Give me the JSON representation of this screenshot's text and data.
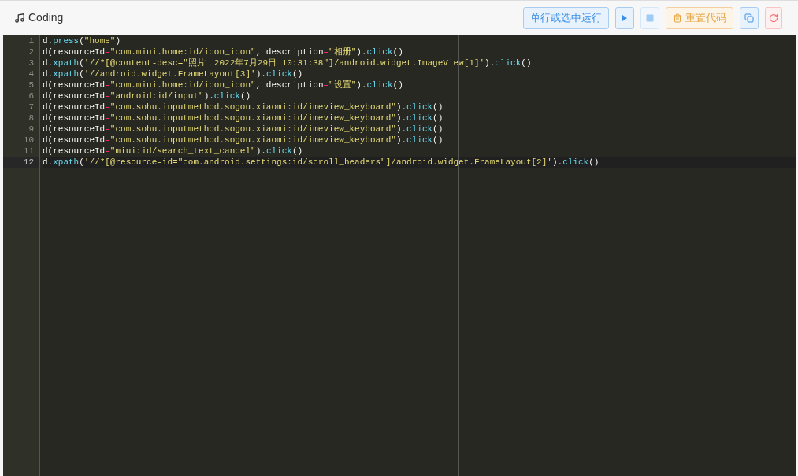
{
  "header": {
    "title": "Coding"
  },
  "toolbar": [
    {
      "kind": "text",
      "label": "单行或选中运行"
    },
    {
      "kind": "play"
    },
    {
      "kind": "stop"
    },
    {
      "kind": "reset",
      "label": "重置代码"
    },
    {
      "kind": "copy"
    },
    {
      "kind": "reload"
    }
  ],
  "editor": {
    "lines": [
      {
        "number": "1",
        "active": false,
        "tokens": [
          {
            "kind": "plain",
            "t": "d."
          },
          {
            "kind": "method",
            "t": "press"
          },
          {
            "kind": "plain",
            "t": "("
          },
          {
            "kind": "string",
            "t": "\"home\""
          },
          {
            "kind": "plain",
            "t": ")"
          }
        ]
      },
      {
        "number": "2",
        "active": false,
        "tokens": [
          {
            "kind": "plain",
            "t": "d(resourceId"
          },
          {
            "kind": "op",
            "t": "="
          },
          {
            "kind": "string",
            "t": "\"com.miui.home:id/icon_icon\""
          },
          {
            "kind": "plain",
            "t": ", description"
          },
          {
            "kind": "op",
            "t": "="
          },
          {
            "kind": "string",
            "t": "\"相册\""
          },
          {
            "kind": "plain",
            "t": ")."
          },
          {
            "kind": "method",
            "t": "click"
          },
          {
            "kind": "plain",
            "t": "()"
          }
        ]
      },
      {
        "number": "3",
        "active": false,
        "tokens": [
          {
            "kind": "plain",
            "t": "d."
          },
          {
            "kind": "method",
            "t": "xpath"
          },
          {
            "kind": "plain",
            "t": "("
          },
          {
            "kind": "string",
            "t": "'//*[@content-desc=\"照片，2022年7月29日 10:31:38\"]/android.widget.ImageView[1]'"
          },
          {
            "kind": "plain",
            "t": ")."
          },
          {
            "kind": "method",
            "t": "click"
          },
          {
            "kind": "plain",
            "t": "()"
          }
        ]
      },
      {
        "number": "4",
        "active": false,
        "tokens": [
          {
            "kind": "plain",
            "t": "d."
          },
          {
            "kind": "method",
            "t": "xpath"
          },
          {
            "kind": "plain",
            "t": "("
          },
          {
            "kind": "string",
            "t": "'//android.widget.FrameLayout[3]'"
          },
          {
            "kind": "plain",
            "t": ")."
          },
          {
            "kind": "method",
            "t": "click"
          },
          {
            "kind": "plain",
            "t": "()"
          }
        ]
      },
      {
        "number": "5",
        "active": false,
        "tokens": [
          {
            "kind": "plain",
            "t": "d(resourceId"
          },
          {
            "kind": "op",
            "t": "="
          },
          {
            "kind": "string",
            "t": "\"com.miui.home:id/icon_icon\""
          },
          {
            "kind": "plain",
            "t": ", description"
          },
          {
            "kind": "op",
            "t": "="
          },
          {
            "kind": "string",
            "t": "\"设置\""
          },
          {
            "kind": "plain",
            "t": ")."
          },
          {
            "kind": "method",
            "t": "click"
          },
          {
            "kind": "plain",
            "t": "()"
          }
        ]
      },
      {
        "number": "6",
        "active": false,
        "tokens": [
          {
            "kind": "plain",
            "t": "d(resourceId"
          },
          {
            "kind": "op",
            "t": "="
          },
          {
            "kind": "string",
            "t": "\"android:id/input\""
          },
          {
            "kind": "plain",
            "t": ")."
          },
          {
            "kind": "method",
            "t": "click"
          },
          {
            "kind": "plain",
            "t": "()"
          }
        ]
      },
      {
        "number": "7",
        "active": false,
        "tokens": [
          {
            "kind": "plain",
            "t": "d(resourceId"
          },
          {
            "kind": "op",
            "t": "="
          },
          {
            "kind": "string",
            "t": "\"com.sohu.inputmethod.sogou.xiaomi:id/imeview_keyboard\""
          },
          {
            "kind": "plain",
            "t": ")."
          },
          {
            "kind": "method",
            "t": "click"
          },
          {
            "kind": "plain",
            "t": "()"
          }
        ]
      },
      {
        "number": "8",
        "active": false,
        "tokens": [
          {
            "kind": "plain",
            "t": "d(resourceId"
          },
          {
            "kind": "op",
            "t": "="
          },
          {
            "kind": "string",
            "t": "\"com.sohu.inputmethod.sogou.xiaomi:id/imeview_keyboard\""
          },
          {
            "kind": "plain",
            "t": ")."
          },
          {
            "kind": "method",
            "t": "click"
          },
          {
            "kind": "plain",
            "t": "()"
          }
        ]
      },
      {
        "number": "9",
        "active": false,
        "tokens": [
          {
            "kind": "plain",
            "t": "d(resourceId"
          },
          {
            "kind": "op",
            "t": "="
          },
          {
            "kind": "string",
            "t": "\"com.sohu.inputmethod.sogou.xiaomi:id/imeview_keyboard\""
          },
          {
            "kind": "plain",
            "t": ")."
          },
          {
            "kind": "method",
            "t": "click"
          },
          {
            "kind": "plain",
            "t": "()"
          }
        ]
      },
      {
        "number": "10",
        "active": false,
        "tokens": [
          {
            "kind": "plain",
            "t": "d(resourceId"
          },
          {
            "kind": "op",
            "t": "="
          },
          {
            "kind": "string",
            "t": "\"com.sohu.inputmethod.sogou.xiaomi:id/imeview_keyboard\""
          },
          {
            "kind": "plain",
            "t": ")."
          },
          {
            "kind": "method",
            "t": "click"
          },
          {
            "kind": "plain",
            "t": "()"
          }
        ]
      },
      {
        "number": "11",
        "active": false,
        "tokens": [
          {
            "kind": "plain",
            "t": "d(resourceId"
          },
          {
            "kind": "op",
            "t": "="
          },
          {
            "kind": "string",
            "t": "\"miui:id/search_text_cancel\""
          },
          {
            "kind": "plain",
            "t": ")."
          },
          {
            "kind": "method",
            "t": "click"
          },
          {
            "kind": "plain",
            "t": "()"
          }
        ]
      },
      {
        "number": "12",
        "active": true,
        "tokens": [
          {
            "kind": "plain",
            "t": "d."
          },
          {
            "kind": "method",
            "t": "xpath"
          },
          {
            "kind": "plain",
            "t": "("
          },
          {
            "kind": "string",
            "t": "'//*[@resource-id=\"com.android.settings:id/scroll_headers\"]/android.widget.FrameLayout[2]'"
          },
          {
            "kind": "plain",
            "t": ")."
          },
          {
            "kind": "method",
            "t": "click"
          },
          {
            "kind": "plain",
            "t": "()"
          }
        ]
      }
    ]
  }
}
